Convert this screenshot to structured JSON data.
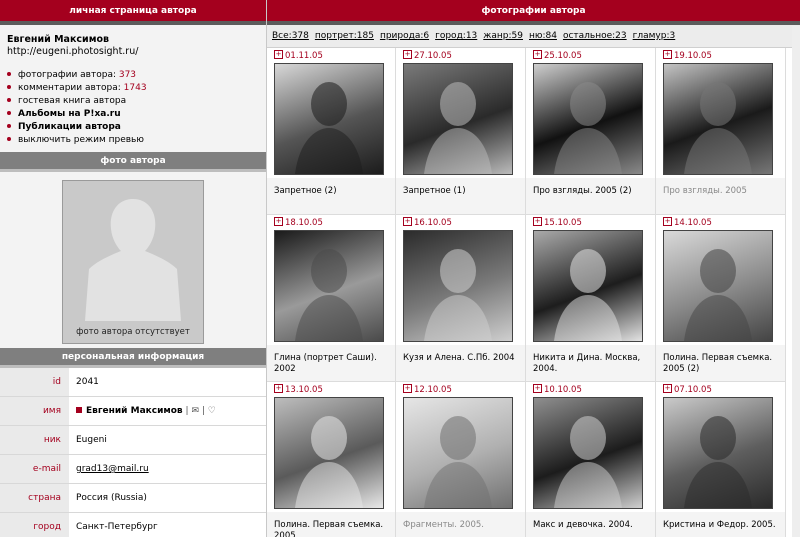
{
  "left": {
    "header": "личная страница автора",
    "author_name": "Евгений Максимов",
    "author_url": "http://eugeni.photosight.ru/",
    "links": [
      {
        "label": "фотографии автора: ",
        "count": "373",
        "bold": false
      },
      {
        "label": "комментарии автора: ",
        "count": "1743",
        "bold": false
      },
      {
        "label": "гостевая книга автора",
        "count": "",
        "bold": false
      },
      {
        "label": "Альбомы на P!xa.ru",
        "count": "",
        "bold": true
      },
      {
        "label": "Публикации автора",
        "count": "",
        "bold": true
      },
      {
        "label": "выключить режим превью",
        "count": "",
        "bold": false
      }
    ],
    "photo_header": "фото автора",
    "no_photo": "фото автора отсутствует",
    "info_header": "персональная информация",
    "info": [
      {
        "key": "id",
        "value": "2041"
      },
      {
        "key": "имя",
        "value": "Евгений Максимов"
      },
      {
        "key": "ник",
        "value": "Eugeni"
      },
      {
        "key": "e-mail",
        "value": "grad13@mail.ru"
      },
      {
        "key": "страна",
        "value": "Россия (Russia)"
      },
      {
        "key": "город",
        "value": "Санкт-Петербург"
      }
    ],
    "accent": "#a4001e"
  },
  "right": {
    "header": "фотографии автора",
    "categories": [
      "Все:378",
      "портрет:185",
      "природа:6",
      "город:13",
      "жанр:59",
      "ню:84",
      "остальное:23",
      "гламур:3"
    ],
    "photos": [
      {
        "date": "01.11.05",
        "title": "Запретное (2)",
        "gray": false
      },
      {
        "date": "27.10.05",
        "title": "Запретное (1)",
        "gray": false
      },
      {
        "date": "25.10.05",
        "title": "Про взгляды. 2005 (2)",
        "gray": false
      },
      {
        "date": "19.10.05",
        "title": "Про взгляды. 2005",
        "gray": true
      },
      {
        "date": "18.10.05",
        "title": "Глина (портрет Саши). 2002",
        "gray": false
      },
      {
        "date": "16.10.05",
        "title": "Кузя и Алена. С.Пб. 2004",
        "gray": false
      },
      {
        "date": "15.10.05",
        "title": "Никита и Дина. Москва, 2004.",
        "gray": false
      },
      {
        "date": "14.10.05",
        "title": "Полина. Первая съемка. 2005 (2)",
        "gray": false
      },
      {
        "date": "13.10.05",
        "title": "Полина. Первая съемка. 2005",
        "gray": false
      },
      {
        "date": "12.10.05",
        "title": "Фрагменты. 2005.",
        "gray": true
      },
      {
        "date": "10.10.05",
        "title": "Макс и девочка. 2004.",
        "gray": false
      },
      {
        "date": "07.10.05",
        "title": "Кристина и Федор. 2005.",
        "gray": false
      }
    ]
  }
}
